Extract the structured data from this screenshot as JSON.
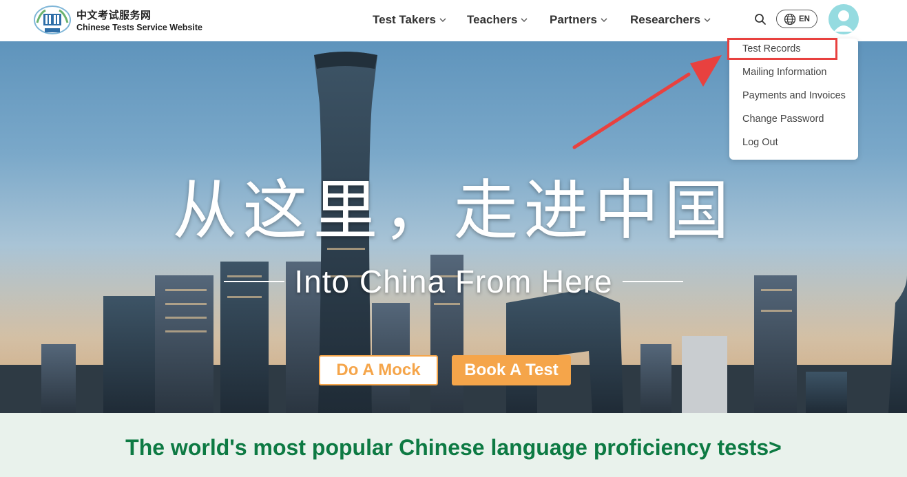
{
  "header": {
    "brand_cn": "中文考试服务网",
    "brand_en": "Chinese Tests Service Website",
    "logo_icon": "hanban-logo-icon",
    "nav": [
      {
        "label": "Test Takers",
        "icon": "chevron-down-icon"
      },
      {
        "label": "Teachers",
        "icon": "chevron-down-icon"
      },
      {
        "label": "Partners",
        "icon": "chevron-down-icon"
      },
      {
        "label": "Researchers",
        "icon": "chevron-down-icon"
      }
    ],
    "search_icon": "search-icon",
    "language": {
      "label": "EN",
      "icon": "globe-icon"
    },
    "avatar_icon": "user-avatar-icon"
  },
  "user_menu": {
    "items": [
      {
        "label": "Test Records"
      },
      {
        "label": "Mailing Information"
      },
      {
        "label": "Payments and Invoices"
      },
      {
        "label": "Change Password"
      },
      {
        "label": "Log Out"
      }
    ],
    "highlighted_item": "Test Records"
  },
  "hero": {
    "headline_cn": "从这里，走进中国",
    "headline_en": "Into China From Here",
    "mock_button": "Do A Mock",
    "book_button": "Book A Test"
  },
  "tagline": "The world's most popular Chinese language proficiency tests>",
  "colors": {
    "accent_orange": "#f5a54a",
    "tagline_green": "#0d7a43",
    "band_background": "#e9f2ec",
    "avatar_teal": "#95dbe0",
    "annotation_red": "#e8413f"
  }
}
